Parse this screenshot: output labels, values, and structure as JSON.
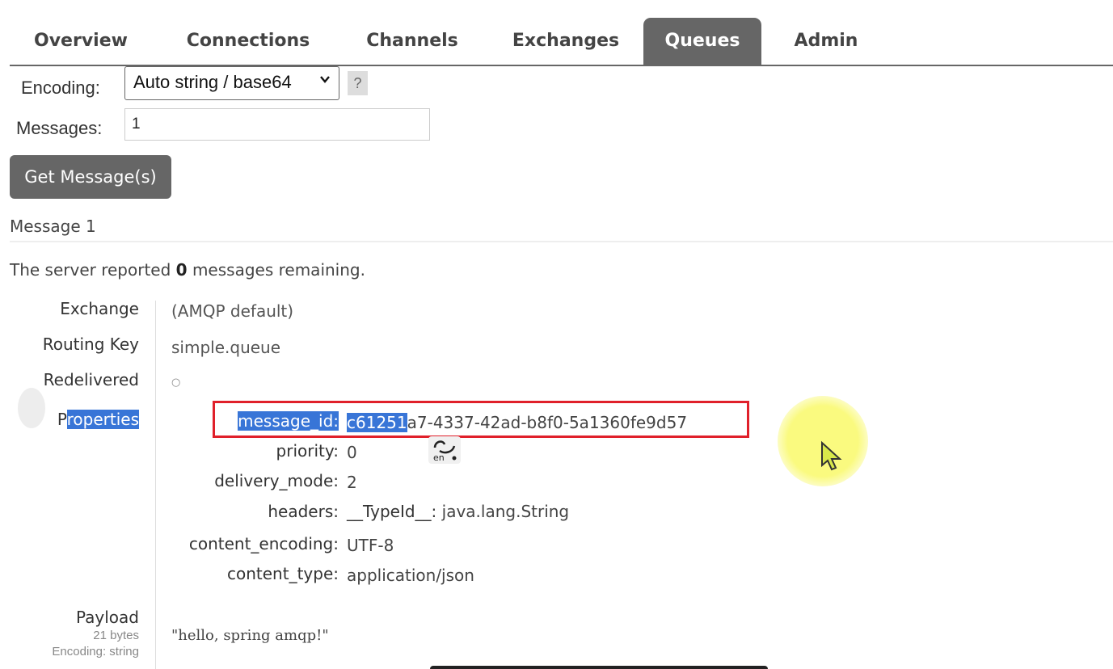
{
  "tabs": [
    "Overview",
    "Connections",
    "Channels",
    "Exchanges",
    "Queues",
    "Admin"
  ],
  "active_tab": "Queues",
  "form": {
    "encoding_label": "Encoding:",
    "encoding_value": "Auto string / base64",
    "help": "?",
    "messages_label": "Messages:",
    "messages_value": "1",
    "get_button": "Get Message(s)"
  },
  "message": {
    "title": "Message 1",
    "server_pre": "The server reported ",
    "server_count": "0",
    "server_post": " messages remaining.",
    "exchange_label": "Exchange",
    "exchange_value": "(AMQP default)",
    "routing_key_label": "Routing Key",
    "routing_key_value": "simple.queue",
    "redelivered_label": "Redelivered",
    "redelivered_value": "○",
    "properties_label_first": "P",
    "properties_label_rest": "roperties",
    "properties": {
      "message_id_label": "message_id:",
      "message_id_sel": "c61251",
      "message_id_rest": "a7-4337-42ad-b8f0-5a1360fe9d57",
      "priority_label": "priority:",
      "priority_value": "0",
      "delivery_mode_label": "delivery_mode:",
      "delivery_mode_value": "2",
      "headers_label": "headers:",
      "headers_key": "__TypeId__:",
      "headers_value": "java.lang.String",
      "content_encoding_label": "content_encoding:",
      "content_encoding_value": "UTF-8",
      "content_type_label": "content_type:",
      "content_type_value": "application/json"
    },
    "payload_label": "Payload",
    "payload_size": "21 bytes",
    "payload_encoding": "Encoding: string",
    "payload_value": "\"hello, spring amqp!\""
  },
  "ime_label": "en",
  "colors": {
    "accent": "#666666",
    "selection": "#3875d7",
    "highlight_box": "#e0202a"
  }
}
